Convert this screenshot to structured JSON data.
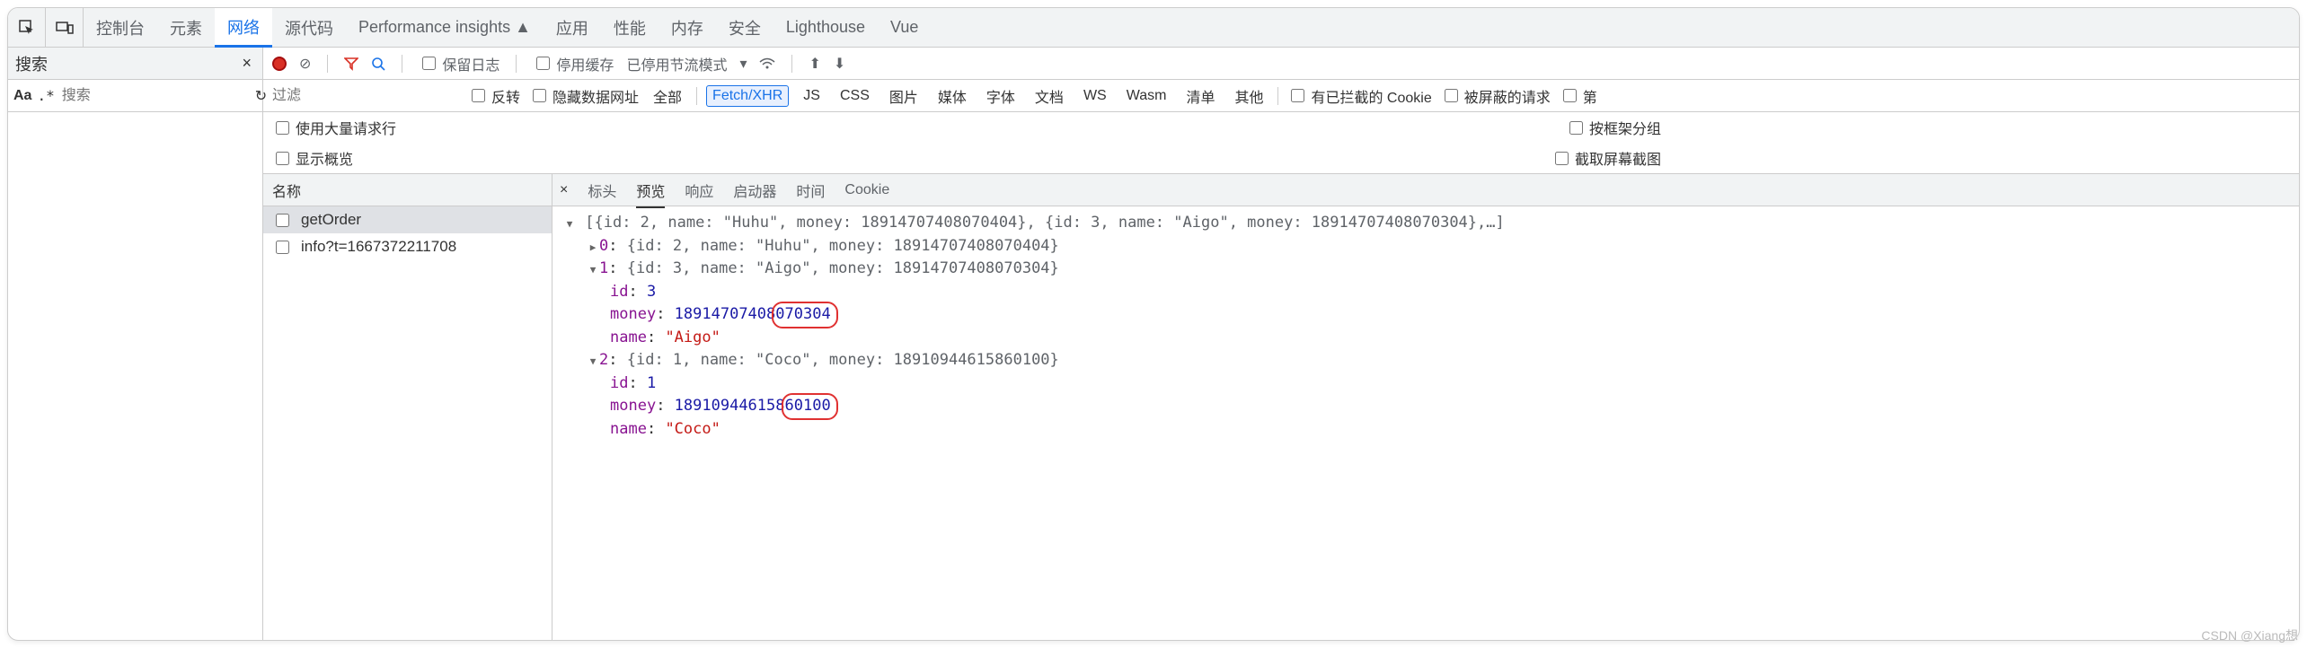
{
  "top_icons": {
    "inspect": "⬚",
    "device": "▭"
  },
  "tabs": {
    "console": "控制台",
    "elements": "元素",
    "network": "网络",
    "sources": "源代码",
    "perf_insights": "Performance insights ▲",
    "application": "应用",
    "performance": "性能",
    "memory": "内存",
    "security": "安全",
    "lighthouse": "Lighthouse",
    "vue": "Vue",
    "active": "网络"
  },
  "search_panel": {
    "title": "搜索",
    "placeholder": "搜索",
    "aa": "Aa",
    "regex": ".*"
  },
  "net_toolbar": {
    "preserve_log": "保留日志",
    "disable_cache": "停用缓存",
    "throttle_label": "已停用节流模式"
  },
  "filter_row": {
    "filter_placeholder": "过滤",
    "invert": "反转",
    "hide_data_urls": "隐藏数据网址",
    "types": [
      "全部",
      "Fetch/XHR",
      "JS",
      "CSS",
      "图片",
      "媒体",
      "字体",
      "文档",
      "WS",
      "Wasm",
      "清单",
      "其他"
    ],
    "active_type": "Fetch/XHR",
    "blocked_cookies": "有已拦截的 Cookie",
    "blocked_requests": "被屏蔽的请求",
    "third_party": "第"
  },
  "options": {
    "large_rows": "使用大量请求行",
    "show_overview": "显示概览",
    "group_by_frame": "按框架分组",
    "screenshots": "截取屏幕截图"
  },
  "requests": {
    "header": "名称",
    "items": [
      {
        "name": "getOrder",
        "selected": true
      },
      {
        "name": "info?t=1667372211708",
        "selected": false
      }
    ]
  },
  "details_tabs": {
    "headers": "标头",
    "preview": "预览",
    "response": "响应",
    "initiator": "启动器",
    "timing": "时间",
    "cookies": "Cookie",
    "active": "预览"
  },
  "preview": {
    "top_summary": "[{id: 2, name: \"Huhu\", money: 18914707408070404}, {id: 3, name: \"Aigo\", money: 18914707408070304},…]",
    "item0": {
      "idx": "0",
      "summary": "{id: 2, name: \"Huhu\", money: 18914707408070404}"
    },
    "item1": {
      "idx": "1",
      "summary": "{id: 3, name: \"Aigo\", money: 18914707408070304}",
      "id_key": "id",
      "id_val": "3",
      "money_key": "money",
      "money_val_a": "18914707408",
      "money_val_b": "070304",
      "name_key": "name",
      "name_val": "\"Aigo\""
    },
    "item2": {
      "idx": "2",
      "summary": "{id: 1, name: \"Coco\", money: 18910944615860100}",
      "id_key": "id",
      "id_val": "1",
      "money_key": "money",
      "money_val_a": "189109446158",
      "money_val_b": "60100",
      "name_key": "name",
      "name_val": "\"Coco\""
    }
  },
  "watermark": "CSDN @Xiang想"
}
